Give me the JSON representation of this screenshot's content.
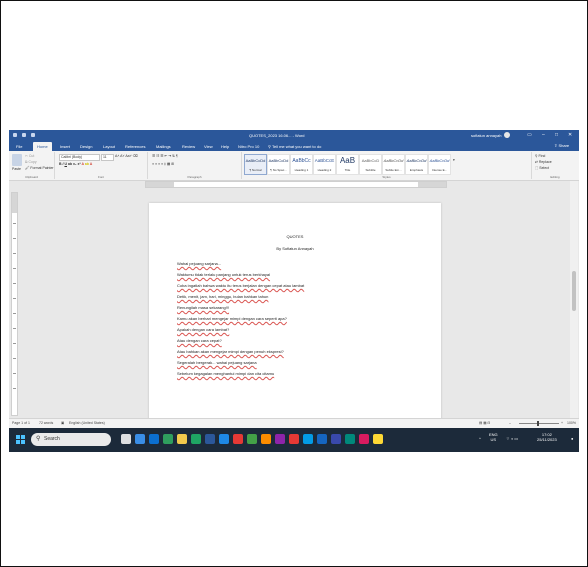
{
  "window": {
    "title": "QUOTES_2023 16.06... - Word",
    "user": "sofiatun annayah",
    "share_label": "Share"
  },
  "tabs": [
    "File",
    "Home",
    "Insert",
    "Design",
    "Layout",
    "References",
    "Mailings",
    "Review",
    "View",
    "Help",
    "Nitro Pro 10",
    "Tell me what you want to do"
  ],
  "ribbon": {
    "clipboard": {
      "paste": "Paste",
      "cut": "Cut",
      "copy": "Copy",
      "format_painter": "Format Painter",
      "label": "Clipboard"
    },
    "font": {
      "family": "Calibri (Body)",
      "size": "11",
      "label": "Font"
    },
    "paragraph": {
      "label": "Paragraph"
    },
    "styles": {
      "label": "Styles",
      "items": [
        {
          "sample": "AaBbCcDd",
          "name": "¶ Normal"
        },
        {
          "sample": "AaBbCcDd",
          "name": "¶ No Spac..."
        },
        {
          "sample": "AaBbCc",
          "name": "Heading 1"
        },
        {
          "sample": "AaBbCcE",
          "name": "Heading 2"
        },
        {
          "sample": "AaB",
          "name": "Title"
        },
        {
          "sample": "AaBbCcD",
          "name": "Subtitle"
        },
        {
          "sample": "AaBbCcDd",
          "name": "Subtle Em..."
        },
        {
          "sample": "AaBbCcDd",
          "name": "Emphasis"
        },
        {
          "sample": "AaBbCcDd",
          "name": "Intense E..."
        }
      ]
    },
    "editing": {
      "find": "Find",
      "replace": "Replace",
      "select": "Select",
      "label": "Editing"
    }
  },
  "document": {
    "heading": "QUOTES",
    "author": "By Sofiatun Annayah",
    "lines": [
      "Wahai pejuang sarjana...",
      "Waktumu tidak terlalu panjang untuk terus berkhayal",
      "Coba ingatlah bahwa waktu itu terus berjalan dengan cepat atau lambat",
      "Detik, menit, jam, hari, minggu, bulan bahkan tahun",
      "Renungilah masa sekarang!!!",
      "Kamu akan berhari mengejar mimpi dengan cara seperti apa?",
      "Apakah dengan cara lambat?",
      "Atau dengan cara cepat?",
      "Atau bahkan akan mengejar mimpi dengan penuh ekspresi?",
      "Segeralah bergerak... wahai pejuang sarjana",
      "Sebelum kegagalan menghantui mimpi dan cita citamu"
    ]
  },
  "status": {
    "page": "Page 1 of 1",
    "words": "72 words",
    "language": "English (United States)",
    "zoom": "100%"
  },
  "taskbar": {
    "search_placeholder": "Search",
    "lang_top": "ENG",
    "lang_bottom": "US",
    "time": "17:02",
    "date": "25/11/2023"
  },
  "colors": {
    "word_blue": "#2b579a",
    "taskbar": "#1c2a3a",
    "spell_underline": "#d9534f"
  }
}
